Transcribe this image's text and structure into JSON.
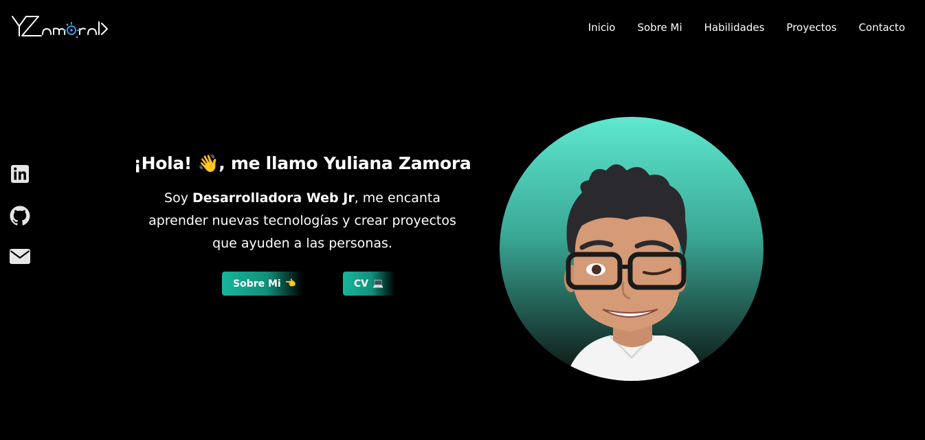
{
  "header": {
    "logo_alt": "YZamora logo",
    "nav": [
      {
        "label": "Inicio"
      },
      {
        "label": "Sobre Mi"
      },
      {
        "label": "Habilidades"
      },
      {
        "label": "Proyectos"
      },
      {
        "label": "Contacto"
      }
    ]
  },
  "social": [
    {
      "icon": "linkedin-icon"
    },
    {
      "icon": "github-icon"
    },
    {
      "icon": "mail-icon"
    }
  ],
  "hero": {
    "title_prefix": "¡Hola! ",
    "title_emoji": "👋",
    "title_suffix": ", me llamo Yuliana Zamora",
    "desc_prefix": "Soy ",
    "desc_bold": "Desarrolladora Web Jr",
    "desc_suffix": ", me encanta aprender nuevas tecnologías y crear proyectos que ayuden a las personas.",
    "buttons": {
      "about_label": "Sobre Mi",
      "about_emoji": "👈",
      "cv_label": "CV",
      "cv_emoji": "💻"
    }
  },
  "colors": {
    "background": "#000000",
    "accent": "#17b59a",
    "avatar_gradient_top": "#5ee8cf",
    "avatar_gradient_bottom": "#0b0f0e"
  }
}
